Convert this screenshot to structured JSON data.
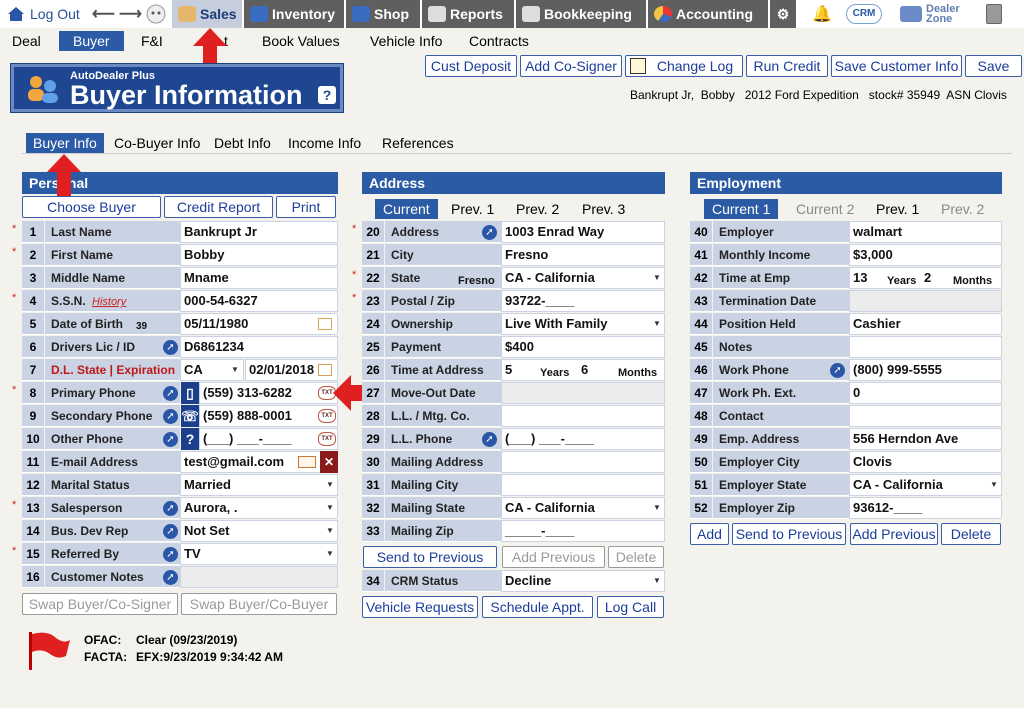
{
  "topnav": {
    "logout": "Log Out",
    "sales": "Sales",
    "inventory": "Inventory",
    "shop": "Shop",
    "reports": "Reports",
    "bookkeeping": "Bookkeeping",
    "accounting": "Accounting",
    "crm": "CRM",
    "dealer_zone": "Dealer Zone"
  },
  "subnav": {
    "deal": "Deal",
    "buyer": "Buyer",
    "fi": "F&I",
    "t": "t",
    "book_values": "Book Values",
    "vehicle_info": "Vehicle Info",
    "contracts": "Contracts"
  },
  "toolbar": {
    "cust_deposit": "Cust Deposit",
    "add_cosigner": "Add Co-Signer",
    "change_log": "Change Log",
    "run_credit": "Run Credit",
    "save_customer_info": "Save Customer Info",
    "save": "Save"
  },
  "logo": {
    "small": "AutoDealer Plus",
    "big": "Buyer Information",
    "help": "?"
  },
  "customer_summary": "Bankrupt Jr,  Bobby   2012 Ford Expedition   stock# 35949  ASN Clovis",
  "tabs": {
    "buyer_info": "Buyer Info",
    "cobuyer_info": "Co-Buyer Info",
    "debt_info": "Debt Info",
    "income_info": "Income Info",
    "references": "References"
  },
  "personal": {
    "title": "Personal",
    "choose_buyer": "Choose Buyer",
    "credit_report": "Credit Report",
    "print": "Print",
    "rows": [
      {
        "n": "1",
        "label": "Last Name",
        "value": "Bankrupt Jr"
      },
      {
        "n": "2",
        "label": "First Name",
        "value": "Bobby"
      },
      {
        "n": "3",
        "label": "Middle Name",
        "value": "Mname"
      },
      {
        "n": "4",
        "label": "S.S.N.",
        "value": "000-54-6327",
        "extra": "History"
      },
      {
        "n": "5",
        "label": "Date of Birth",
        "value": "05/11/1980",
        "extra": "39"
      },
      {
        "n": "6",
        "label": "Drivers Lic / ID",
        "value": "D6861234"
      },
      {
        "n": "7",
        "label": "D.L. State | Expiration",
        "value": "CA",
        "value2": "02/01/2018"
      },
      {
        "n": "8",
        "label": "Primary Phone",
        "value": "(559) 313-6282"
      },
      {
        "n": "9",
        "label": "Secondary Phone",
        "value": "(559) 888-0001"
      },
      {
        "n": "10",
        "label": "Other Phone",
        "value": "(___) ___-____"
      },
      {
        "n": "11",
        "label": "E-mail Address",
        "value": "test@gmail.com"
      },
      {
        "n": "12",
        "label": "Marital Status",
        "value": "Married"
      },
      {
        "n": "13",
        "label": "Salesperson",
        "value": "Aurora, ."
      },
      {
        "n": "14",
        "label": "Bus. Dev Rep",
        "value": "Not Set"
      },
      {
        "n": "15",
        "label": "Referred By",
        "value": "TV"
      },
      {
        "n": "16",
        "label": "Customer Notes",
        "value": ""
      }
    ],
    "swap1": "Swap Buyer/Co-Signer",
    "swap2": "Swap Buyer/Co-Buyer"
  },
  "address": {
    "title": "Address",
    "tabs": [
      "Current",
      "Prev. 1",
      "Prev. 2",
      "Prev. 3"
    ],
    "rows": [
      {
        "n": "20",
        "label": "Address",
        "value": "1003 Enrad Way"
      },
      {
        "n": "21",
        "label": "City",
        "value": "Fresno"
      },
      {
        "n": "22",
        "label": "State",
        "value": "CA - California",
        "extra": "Fresno"
      },
      {
        "n": "23",
        "label": "Postal / Zip",
        "value": "93722-____"
      },
      {
        "n": "24",
        "label": "Ownership",
        "value": "Live With Family"
      },
      {
        "n": "25",
        "label": "Payment",
        "value": "$400"
      },
      {
        "n": "26",
        "label": "Time at Address",
        "value": "5",
        "years_label": "Years",
        "months_value": "6",
        "months_label": "Months"
      },
      {
        "n": "27",
        "label": "Move-Out Date",
        "value": ""
      },
      {
        "n": "28",
        "label": "L.L. / Mtg. Co.",
        "value": ""
      },
      {
        "n": "29",
        "label": "L.L. Phone",
        "value": "(___) ___-____"
      },
      {
        "n": "30",
        "label": "Mailing Address",
        "value": ""
      },
      {
        "n": "31",
        "label": "Mailing City",
        "value": ""
      },
      {
        "n": "32",
        "label": "Mailing State",
        "value": "CA - California"
      },
      {
        "n": "33",
        "label": "Mailing Zip",
        "value": "_____-____"
      }
    ],
    "send_to_previous": "Send to Previous",
    "add_previous": "Add Previous",
    "delete": "Delete",
    "crm_row": {
      "n": "34",
      "label": "CRM Status",
      "value": "Decline"
    },
    "vehicle_requests": "Vehicle Requests",
    "schedule_appt": "Schedule Appt.",
    "log_call": "Log Call"
  },
  "employment": {
    "title": "Employment",
    "tabs": [
      "Current 1",
      "Current 2",
      "Prev. 1",
      "Prev. 2"
    ],
    "rows": [
      {
        "n": "40",
        "label": "Employer",
        "value": "walmart"
      },
      {
        "n": "41",
        "label": "Monthly Income",
        "value": "$3,000"
      },
      {
        "n": "42",
        "label": "Time at Emp",
        "value": "13",
        "years_label": "Years",
        "months_value": "2",
        "months_label": "Months"
      },
      {
        "n": "43",
        "label": "Termination Date",
        "value": ""
      },
      {
        "n": "44",
        "label": "Position Held",
        "value": "Cashier"
      },
      {
        "n": "45",
        "label": "Notes",
        "value": ""
      },
      {
        "n": "46",
        "label": "Work Phone",
        "value": "(800) 999-5555"
      },
      {
        "n": "47",
        "label": "Work Ph. Ext.",
        "value": "0"
      },
      {
        "n": "48",
        "label": "Contact",
        "value": ""
      },
      {
        "n": "49",
        "label": "Emp. Address",
        "value": "556 Herndon Ave"
      },
      {
        "n": "50",
        "label": "Employer City",
        "value": "Clovis"
      },
      {
        "n": "51",
        "label": "Employer State",
        "value": "CA - California"
      },
      {
        "n": "52",
        "label": "Employer Zip",
        "value": "93612-____"
      }
    ],
    "add": "Add",
    "send_to_previous": "Send to Previous",
    "add_previous": "Add Previous",
    "delete": "Delete"
  },
  "footer": {
    "ofac_label": "OFAC:",
    "ofac_value": "Clear  (09/23/2019)",
    "facta_label": "FACTA:",
    "facta_value": "EFX:9/23/2019 9:34:42 AM"
  },
  "txt_icon": "TXT"
}
